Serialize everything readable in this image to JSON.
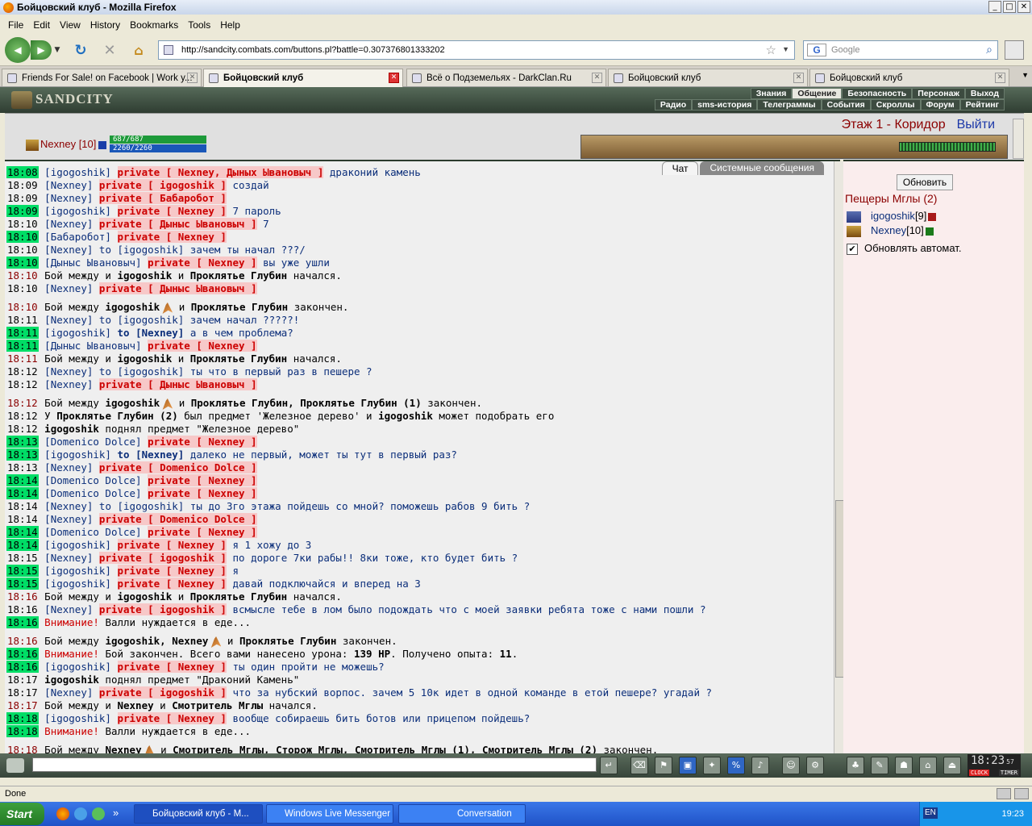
{
  "window": {
    "title": "Бойцовский клуб - Mozilla Firefox"
  },
  "menu": [
    "File",
    "Edit",
    "View",
    "History",
    "Bookmarks",
    "Tools",
    "Help"
  ],
  "url": "http://sandcity.combats.com/buttons.pl?battle=0.307376801333202",
  "search_placeholder": "Google",
  "tabs": [
    {
      "label": "Friends For Sale! on Facebook | Work y...",
      "active": false
    },
    {
      "label": "Бойцовский клуб",
      "active": true
    },
    {
      "label": "Всё о Подземельях - DarkClan.Ru",
      "active": false
    },
    {
      "label": "Бойцовский клуб",
      "active": false
    },
    {
      "label": "Бойцовский клуб",
      "active": false
    }
  ],
  "game": {
    "logo": "SANDCITY",
    "menu_top": [
      "Знания",
      "Общение",
      "Безопасность",
      "Персонаж",
      "Выход"
    ],
    "menu_sub": [
      "Радио",
      "sms-история",
      "Телеграммы",
      "События",
      "Скроллы",
      "Форум",
      "Рейтинг"
    ],
    "player": "Nexney [10]",
    "hp": "687/687",
    "mana": "2260/2260",
    "floor": "Этаж 1 - Коридор",
    "exit": "Выйти",
    "chat_tabs": [
      "Чат",
      "Системные сообщения"
    ],
    "refresh": "Обновить",
    "location": "Пещеры Мглы (2)",
    "players": [
      {
        "name": "igogoshik",
        "level": "[9]"
      },
      {
        "name": "Nexney",
        "level": "[10]"
      }
    ],
    "auto_refresh": "Обновлять автомат.",
    "clock": "18:23",
    "clock_seconds": "57",
    "clock_label": "CLOCK",
    "timer_label": "TIMER"
  },
  "chat": [
    {
      "t": "18:08",
      "hl": true,
      "html": "<span class='nm'>[igogoshik]</span> <span class='pv'>private [ Nexney, Дыных Ывановыч ]</span> <span class='msg'>драконий камень</span>"
    },
    {
      "t": "18:09",
      "hl": false,
      "html": "<span class='nm'>[Nexney]</span> <span class='pv'>private [ igogoshik ]</span> <span class='msg'>создай</span>"
    },
    {
      "t": "18:09",
      "hl": false,
      "html": "<span class='nm'>[Nexney]</span> <span class='pv'>private [ Бабаробот ]</span>"
    },
    {
      "t": "18:09",
      "hl": true,
      "html": "<span class='nm'>[igogoshik]</span> <span class='pv'>private [ Nexney ]</span> <span class='msg'>7 пароль</span>"
    },
    {
      "t": "18:10",
      "hl": false,
      "html": "<span class='nm'>[Nexney]</span> <span class='pv'>private [ Дыныс Ывановыч ]</span> <span class='msg'>7</span>"
    },
    {
      "t": "18:10",
      "hl": true,
      "html": "<span class='nm'>[Бабаробот]</span> <span class='pv'>private [ Nexney ]</span>"
    },
    {
      "t": "18:10",
      "hl": false,
      "html": "<span class='nm'>[Nexney]</span> <span class='msg'>to [igogoshik] зачем ты начал ???/</span>"
    },
    {
      "t": "18:10",
      "hl": true,
      "html": "<span class='nm'>[Дыныс Ывановыч]</span> <span class='pv'>private [ Nexney ]</span> <span class='msg'>вы уже ушли</span>"
    },
    {
      "t": "18:10",
      "pl": true,
      "html": "<span class='sys'>Бой между и <b>igogoshik</b> и <b>Проклятье Глубин</b> начался.</span>"
    },
    {
      "t": "18:10",
      "hl": false,
      "html": "<span class='nm'>[Nexney]</span> <span class='pv'>private [ Дыныс Ывановыч ]</span>"
    },
    {
      "t": "18:10",
      "pl": true,
      "tall": true,
      "html": "<span class='sys'>Бой между <b>igogoshik</b><span class='foot'></span> и <b>Проклятье Глубин</b> закончен.</span>"
    },
    {
      "t": "18:11",
      "hl": false,
      "html": "<span class='nm'>[Nexney]</span> <span class='msg'>to [igogoshik] зачем начал ?????!</span>"
    },
    {
      "t": "18:11",
      "hl": true,
      "html": "<span class='nm'>[igogoshik]</span> <span class='nm'><b>to [Nexney]</b></span> <span class='msg'>а в чем проблема?</span>"
    },
    {
      "t": "18:11",
      "hl": true,
      "html": "<span class='nm'>[Дыныс Ывановыч]</span> <span class='pv'>private [ Nexney ]</span>"
    },
    {
      "t": "18:11",
      "pl": true,
      "html": "<span class='sys'>Бой между и <b>igogoshik</b> и <b>Проклятье Глубин</b> начался.</span>"
    },
    {
      "t": "18:12",
      "hl": false,
      "html": "<span class='nm'>[Nexney]</span> <span class='msg'>to [igogoshik] ты что в первый раз в пешере ?</span>"
    },
    {
      "t": "18:12",
      "hl": false,
      "html": "<span class='nm'>[Nexney]</span> <span class='pv'>private [ Дыныс Ывановыч ]</span>"
    },
    {
      "t": "18:12",
      "pl": true,
      "tall": true,
      "html": "<span class='sys'>Бой между <b>igogoshik</b><span class='foot'></span> и <b>Проклятье Глубин, Проклятье Глубин (1)</b> закончен.</span>"
    },
    {
      "t": "18:12",
      "pl": false,
      "html": "<span class='sys'>У <b>Проклятье Глубин (2)</b> был предмет 'Железное дерево' и <b>igogoshik</b> может подобрать его</span>"
    },
    {
      "t": "18:12",
      "pl": false,
      "html": "<span class='sys'><b>igogoshik</b> поднял предмет \"Железное дерево\"</span>"
    },
    {
      "t": "18:13",
      "hl": true,
      "html": "<span class='nm'>[Domenico Dolce]</span> <span class='pv'>private [ Nexney ]</span>"
    },
    {
      "t": "18:13",
      "hl": true,
      "html": "<span class='nm'>[igogoshik]</span> <span class='nm'><b>to [Nexney]</b></span> <span class='msg'>далеко не первый, может ты тут в первый раз?</span>"
    },
    {
      "t": "18:13",
      "hl": false,
      "html": "<span class='nm'>[Nexney]</span> <span class='pv'>private [ Domenico Dolce ]</span>"
    },
    {
      "t": "18:14",
      "hl": true,
      "html": "<span class='nm'>[Domenico Dolce]</span> <span class='pv'>private [ Nexney ]</span>"
    },
    {
      "t": "18:14",
      "hl": true,
      "html": "<span class='nm'>[Domenico Dolce]</span> <span class='pv'>private [ Nexney ]</span>"
    },
    {
      "t": "18:14",
      "hl": false,
      "html": "<span class='nm'>[Nexney]</span> <span class='msg'>to [igogoshik] ты до 3го этажа пойдешь со мной? поможешь рабов 9 бить ?</span>"
    },
    {
      "t": "18:14",
      "hl": false,
      "html": "<span class='nm'>[Nexney]</span> <span class='pv'>private [ Domenico Dolce ]</span>"
    },
    {
      "t": "18:14",
      "hl": true,
      "html": "<span class='nm'>[Domenico Dolce]</span> <span class='pv'>private [ Nexney ]</span>"
    },
    {
      "t": "18:14",
      "hl": true,
      "html": "<span class='nm'>[igogoshik]</span> <span class='pv'>private [ Nexney ]</span> <span class='msg'>я 1 хожу до 3</span>"
    },
    {
      "t": "18:15",
      "hl": false,
      "html": "<span class='nm'>[Nexney]</span> <span class='pv'>private [ igogoshik ]</span> <span class='msg'>по дороге 7ки рабы!! 8ки тоже, кто будет бить ?</span>"
    },
    {
      "t": "18:15",
      "hl": true,
      "html": "<span class='nm'>[igogoshik]</span> <span class='pv'>private [ Nexney ]</span> <span class='msg'>я</span>"
    },
    {
      "t": "18:15",
      "hl": true,
      "html": "<span class='nm'>[igogoshik]</span> <span class='pv'>private [ Nexney ]</span> <span class='msg'>давай подключайся и вперед на 3</span>"
    },
    {
      "t": "18:16",
      "pl": true,
      "html": "<span class='sys'>Бой между и <b>igogoshik</b> и <b>Проклятье Глубин</b> начался.</span>"
    },
    {
      "t": "18:16",
      "hl": false,
      "html": "<span class='nm'>[Nexney]</span> <span class='pv'>private [ igogoshik ]</span> <span class='msg'>всмысле тебе в лом было подождать что с моей заявки ребята тоже с нами пошли ?</span>"
    },
    {
      "t": "18:16",
      "hl": true,
      "html": "<span class='warn'>Внимание!</span> <span class='sys'>Валли нуждается в еде...</span>"
    },
    {
      "t": "18:16",
      "pl": true,
      "tall": true,
      "html": "<span class='sys'>Бой между <b>igogoshik, Nexney</b><span class='foot'></span> и <b>Проклятье Глубин</b> закончен.</span>"
    },
    {
      "t": "18:16",
      "hl": true,
      "html": "<span class='warn'>Внимание!</span> <span class='sys'>Бой закончен. Всего вами нанесено урона: <b>139 HP</b>. Получено опыта: <b>11</b>.</span>"
    },
    {
      "t": "18:16",
      "hl": true,
      "html": "<span class='nm'>[igogoshik]</span> <span class='pv'>private [ Nexney ]</span> <span class='msg'>ты один пройти не можешь?</span>"
    },
    {
      "t": "18:17",
      "pl": false,
      "html": "<span class='sys'><b>igogoshik</b> поднял предмет \"Драконий Камень\"</span>"
    },
    {
      "t": "18:17",
      "hl": false,
      "html": "<span class='nm'>[Nexney]</span> <span class='pv'>private [ igogoshik ]</span> <span class='msg'>что за нубский ворпос. зачем 5 10к идет в одной команде в етой пешере? угадай ?</span>"
    },
    {
      "t": "18:17",
      "pl": true,
      "html": "<span class='sys'>Бой между и <b>Nexney</b> и <b>Смотритель Мглы</b> начался.</span>"
    },
    {
      "t": "18:18",
      "hl": true,
      "html": "<span class='nm'>[igogoshik]</span> <span class='pv'>private [ Nexney ]</span> <span class='msg'>вообще собираешь бить ботов или прицепом пойдешь?</span>"
    },
    {
      "t": "18:18",
      "hl": true,
      "html": "<span class='warn'>Внимание!</span> <span class='sys'>Валли нуждается в еде...</span>"
    },
    {
      "t": "18:18",
      "pl": true,
      "tall": true,
      "html": "<span class='sys'>Бой между <b>Nexney</b><span class='foot'></span> и <b>Смотритель Мглы, Сторож Мглы, Смотритель Мглы (1), Смотритель Мглы (2)</b> закончен.</span>"
    }
  ],
  "statusbar": "Done",
  "taskbar": {
    "start": "Start",
    "buttons": [
      {
        "label": "Бойцовский клуб - M...",
        "active": true
      },
      {
        "label": "Windows Live Messenger",
        "active": false
      },
      {
        "label": "Conversation",
        "active": false
      }
    ],
    "tray_lang": "EN",
    "time": "19:23"
  }
}
